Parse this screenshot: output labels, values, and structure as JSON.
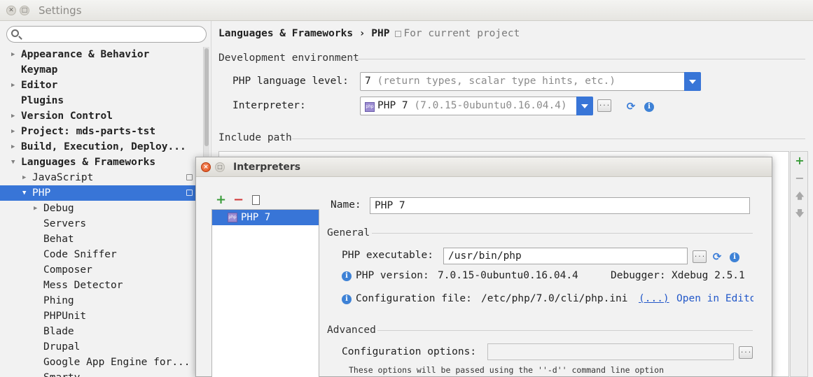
{
  "window": {
    "title": "Settings",
    "close_glyph": "✕",
    "max_glyph": "□"
  },
  "search": {
    "placeholder": ""
  },
  "tree": [
    {
      "label": "Appearance & Behavior",
      "arrow": "▶",
      "bold": true,
      "indent": 0
    },
    {
      "label": "Keymap",
      "arrow": "",
      "bold": true,
      "indent": 0
    },
    {
      "label": "Editor",
      "arrow": "▶",
      "bold": true,
      "indent": 0
    },
    {
      "label": "Plugins",
      "arrow": "",
      "bold": true,
      "indent": 0
    },
    {
      "label": "Version Control",
      "arrow": "▶",
      "bold": true,
      "indent": 0
    },
    {
      "label": "Project: mds-parts-tst",
      "arrow": "▶",
      "bold": true,
      "indent": 0
    },
    {
      "label": "Build, Execution, Deploy...",
      "arrow": "▶",
      "bold": true,
      "indent": 0
    },
    {
      "label": "Languages & Frameworks",
      "arrow": "▼",
      "bold": true,
      "indent": 0
    },
    {
      "label": "JavaScript",
      "arrow": "▶",
      "bold": false,
      "indent": 1,
      "project": true
    },
    {
      "label": "PHP",
      "arrow": "▼",
      "bold": false,
      "indent": 1,
      "project": true,
      "selected": true
    },
    {
      "label": "Debug",
      "arrow": "▶",
      "bold": false,
      "indent": 2
    },
    {
      "label": "Servers",
      "arrow": "",
      "bold": false,
      "indent": 2
    },
    {
      "label": "Behat",
      "arrow": "",
      "bold": false,
      "indent": 2
    },
    {
      "label": "Code Sniffer",
      "arrow": "",
      "bold": false,
      "indent": 2
    },
    {
      "label": "Composer",
      "arrow": "",
      "bold": false,
      "indent": 2
    },
    {
      "label": "Mess Detector",
      "arrow": "",
      "bold": false,
      "indent": 2
    },
    {
      "label": "Phing",
      "arrow": "",
      "bold": false,
      "indent": 2
    },
    {
      "label": "PHPUnit",
      "arrow": "",
      "bold": false,
      "indent": 2
    },
    {
      "label": "Blade",
      "arrow": "",
      "bold": false,
      "indent": 2
    },
    {
      "label": "Drupal",
      "arrow": "",
      "bold": false,
      "indent": 2
    },
    {
      "label": "Google App Engine for...",
      "arrow": "",
      "bold": false,
      "indent": 2
    },
    {
      "label": "Smarty",
      "arrow": "",
      "bold": false,
      "indent": 2
    }
  ],
  "breadcrumb": {
    "part1": "Languages & Frameworks",
    "sep": "›",
    "part2": "PHP",
    "hint": "For current project"
  },
  "dev_env": {
    "section": "Development environment",
    "lang_level_label": "PHP language level:",
    "lang_level_value": "7",
    "lang_level_desc": "(return types, scalar type hints, etc.)",
    "interpreter_label": "Interpreter:",
    "interpreter_name": "PHP 7",
    "interpreter_version": "(7.0.15-0ubuntu0.16.04.4)",
    "browse_glyph": "...",
    "refresh_glyph": "⟳",
    "info_glyph": "i"
  },
  "include_path": {
    "section": "Include path"
  },
  "side_tools": {
    "add": "+",
    "remove": "−",
    "up": "🡅",
    "down": "🡇"
  },
  "dialog": {
    "title": "Interpreters",
    "close_glyph": "×",
    "max_glyph": "□",
    "add": "+",
    "remove": "−",
    "list": [
      {
        "name": "PHP 7"
      }
    ],
    "php_icon_text": "php",
    "name_label": "Name:",
    "name_value": "PHP 7",
    "general": "General",
    "exe_label": "PHP executable:",
    "exe_value": "/usr/bin/php",
    "version_label": "PHP version:",
    "version_value": "7.0.15-0ubuntu0.16.04.4",
    "debugger_label": "Debugger:",
    "debugger_value": "Xdebug 2.5.1",
    "config_label": "Configuration file:",
    "config_value": "/etc/php/7.0/cli/php.ini",
    "config_link": "(...)",
    "open_editor": "Open in Edito",
    "advanced": "Advanced",
    "options_label": "Configuration options:",
    "options_value": "",
    "options_hint": "These options will be passed using the ''-d'' command line option"
  },
  "colors": {
    "selection": "#3875d7",
    "link": "#2459c9",
    "add_green": "#3a9c3a",
    "remove_red": "#d23a3a",
    "info_blue": "#3e82d6"
  }
}
